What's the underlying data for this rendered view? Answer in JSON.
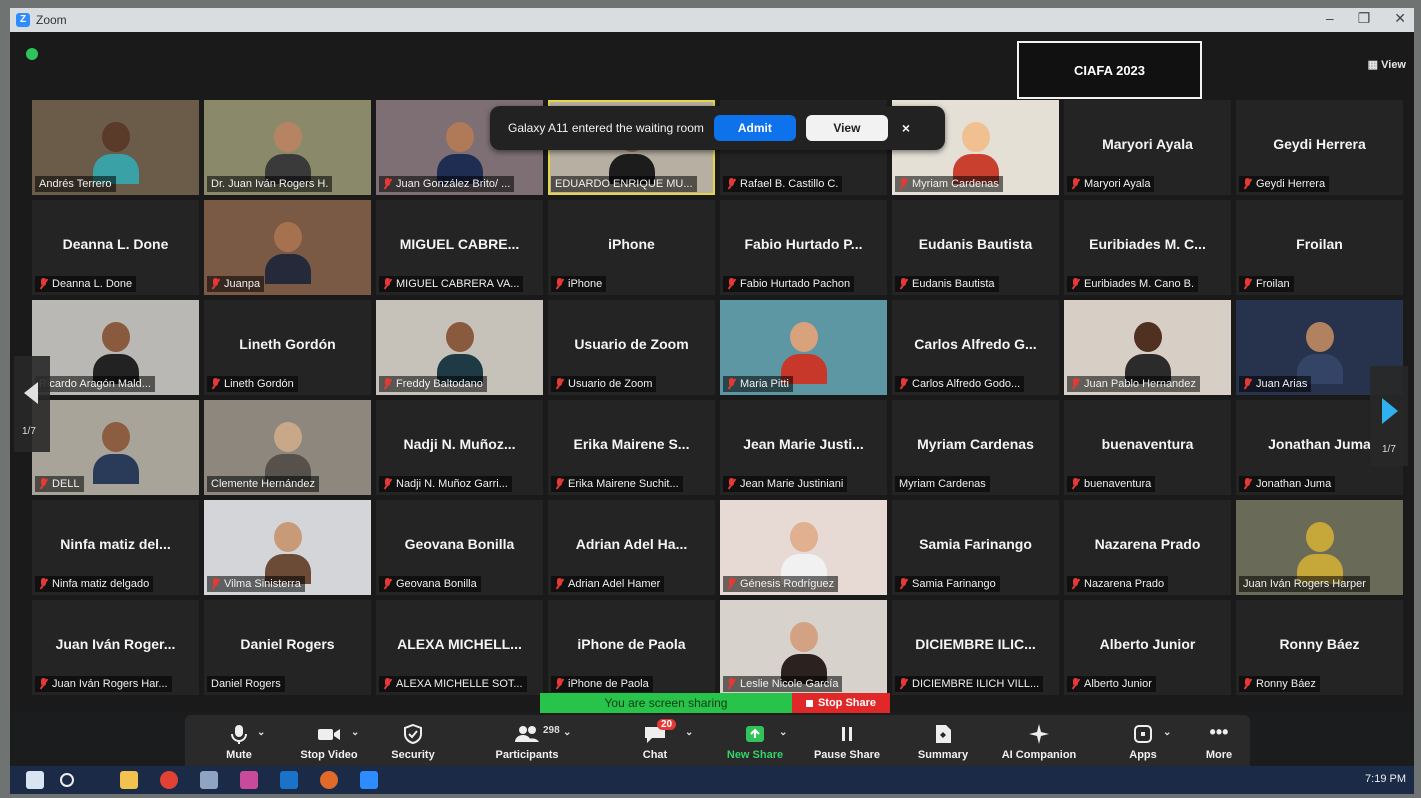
{
  "window": {
    "app_name": "Zoom",
    "view_label": "View"
  },
  "banner": {
    "text": "CIAFA 2023"
  },
  "waiting_room": {
    "message": "Galaxy A11 entered the waiting room",
    "admit_label": "Admit",
    "view_label": "View",
    "close_glyph": "×"
  },
  "pager": {
    "left_page": "1/7",
    "right_page": "1/7"
  },
  "tiles": [
    {
      "video": true,
      "bg": "#6b5b49",
      "skin": "#5a3a28",
      "shirt": "#3aa2a6",
      "label": "Andrés Terrero",
      "muted": false
    },
    {
      "video": true,
      "bg": "#8a8a6a",
      "skin": "#b68463",
      "shirt": "#3a3a3a",
      "label": "Dr. Juan Iván Rogers H.",
      "muted": false
    },
    {
      "video": true,
      "bg": "#7d6f73",
      "skin": "#b07a58",
      "shirt": "#1f2d52",
      "label": "Juan González Brito/ ...",
      "muted": true
    },
    {
      "video": true,
      "bg": "#b7b0a2",
      "skin": "#a07056",
      "shirt": "#1c1c1c",
      "label": "EDUARDO ENRIQUE MU...",
      "muted": false,
      "active": true
    },
    {
      "video": false,
      "name": "Rafael B. Castill...",
      "label": "Rafael B. Castillo C.",
      "muted": true
    },
    {
      "video": true,
      "bg": "#e5e0d6",
      "skin": "#f0c090",
      "shirt": "#c9412e",
      "label": "Myriam Cardenas",
      "muted": true
    },
    {
      "video": false,
      "name": "Maryori Ayala",
      "label": "Maryori Ayala",
      "muted": true
    },
    {
      "video": false,
      "name": "Geydi Herrera",
      "label": "Geydi Herrera",
      "muted": true
    },
    {
      "video": false,
      "name": "Deanna L. Done",
      "label": "Deanna L. Done",
      "muted": true
    },
    {
      "video": true,
      "bg": "#7a5a45",
      "skin": "#a6714f",
      "shirt": "#242a3a",
      "label": "Juanpa",
      "muted": true
    },
    {
      "video": false,
      "name": "MIGUEL CABRE...",
      "label": "MIGUEL CABRERA VA...",
      "muted": true
    },
    {
      "video": false,
      "name": "iPhone",
      "label": "iPhone",
      "muted": true
    },
    {
      "video": false,
      "name": "Fabio Hurtado P...",
      "label": "Fabio Hurtado Pachon",
      "muted": true
    },
    {
      "video": false,
      "name": "Eudanis Bautista",
      "label": "Eudanis Bautista",
      "muted": true
    },
    {
      "video": false,
      "name": "Euribiades M. C...",
      "label": "Euribiades M. Cano B.",
      "muted": true
    },
    {
      "video": false,
      "name": "Froilan",
      "label": "Froilan",
      "muted": true
    },
    {
      "video": true,
      "bg": "#b9b8b4",
      "skin": "#8a5a3e",
      "shirt": "#222222",
      "label": "Ricardo Aragón Mald...",
      "muted": false
    },
    {
      "video": false,
      "name": "Lineth Gordón",
      "label": "Lineth Gordón",
      "muted": true
    },
    {
      "video": true,
      "bg": "#c6c2b9",
      "skin": "#8a5a3e",
      "shirt": "#1e3a44",
      "label": "Freddy Baltodano",
      "muted": true
    },
    {
      "video": false,
      "name": "Usuario de Zoom",
      "label": "Usuario de Zoom",
      "muted": true
    },
    {
      "video": true,
      "bg": "#5e97a4",
      "skin": "#d8a27c",
      "shirt": "#c7382a",
      "label": "Maria Pitti",
      "muted": true
    },
    {
      "video": false,
      "name": "Carlos Alfredo G...",
      "label": "Carlos Alfredo Godo...",
      "muted": true
    },
    {
      "video": true,
      "bg": "#d7cfc5",
      "skin": "#4f3021",
      "shirt": "#2b2b2b",
      "label": "Juan Pablo Hernandez",
      "muted": true
    },
    {
      "video": true,
      "bg": "#27324d",
      "skin": "#b0825f",
      "shirt": "#334466",
      "label": "Juan Arias",
      "muted": true
    },
    {
      "video": true,
      "bg": "#a9a49a",
      "skin": "#8c5d40",
      "shirt": "#2a3b5a",
      "label": "DELL",
      "muted": true
    },
    {
      "video": true,
      "bg": "#8d877d",
      "skin": "#c9a88a",
      "shirt": "#56524b",
      "label": "Clemente Hernández",
      "muted": false
    },
    {
      "video": false,
      "name": "Nadji N. Muñoz...",
      "label": "Nadji N. Muñoz Garri...",
      "muted": true
    },
    {
      "video": false,
      "name": "Erika  Mairene S...",
      "label": "Erika  Mairene Suchit...",
      "muted": true
    },
    {
      "video": false,
      "name": "Jean Marie Justi...",
      "label": "Jean Marie Justiniani",
      "muted": true
    },
    {
      "video": false,
      "name": "Myriam Cardenas",
      "label": "Myriam Cardenas",
      "muted": false
    },
    {
      "video": false,
      "name": "buenaventura",
      "label": "buenaventura",
      "muted": true
    },
    {
      "video": false,
      "name": "Jonathan Juma",
      "label": "Jonathan Juma",
      "muted": true
    },
    {
      "video": false,
      "name": "Ninfa matiz del...",
      "label": "Ninfa matiz delgado",
      "muted": true
    },
    {
      "video": true,
      "bg": "#d3d5d8",
      "skin": "#c99a78",
      "shirt": "#6b4a36",
      "label": "Vilma Sinisterra",
      "muted": true
    },
    {
      "video": false,
      "name": "Geovana Bonilla",
      "label": "Geovana Bonilla",
      "muted": true
    },
    {
      "video": false,
      "name": "Adrian Adel Ha...",
      "label": "Adrian Adel Hamer",
      "muted": true
    },
    {
      "video": true,
      "bg": "#e7d9d3",
      "skin": "#e0b090",
      "shirt": "#f1f1f1",
      "label": "Génesis Rodríguez",
      "muted": true
    },
    {
      "video": false,
      "name": "Samia Farinango",
      "label": "Samia Farinango",
      "muted": true
    },
    {
      "video": false,
      "name": "Nazarena Prado",
      "label": "Nazarena Prado",
      "muted": true
    },
    {
      "video": true,
      "bg": "#6a6a58",
      "skin": "#c6a83a",
      "shirt": "#c6a83a",
      "label": "Juan Iván Rogers Harper",
      "muted": false
    },
    {
      "video": false,
      "name": "Juan Iván Roger...",
      "label": "Juan Iván Rogers Har...",
      "muted": true
    },
    {
      "video": false,
      "name": "Daniel Rogers",
      "label": "Daniel Rogers",
      "muted": false
    },
    {
      "video": false,
      "name": "ALEXA MICHELL...",
      "label": "ALEXA MICHELLE SOT...",
      "muted": true
    },
    {
      "video": false,
      "name": "iPhone de Paola",
      "label": "iPhone de Paola",
      "muted": true
    },
    {
      "video": true,
      "bg": "#d8d2cc",
      "skin": "#d3a282",
      "shirt": "#2b2220",
      "label": "Leslie Nicole García",
      "muted": true
    },
    {
      "video": false,
      "name": "DICIEMBRE ILIC...",
      "label": "DICIEMBRE ILICH VILL...",
      "muted": true
    },
    {
      "video": false,
      "name": "Alberto Junior",
      "label": "Alberto Junior",
      "muted": true
    },
    {
      "video": false,
      "name": "Ronny Báez",
      "label": "Ronny Báez",
      "muted": true
    }
  ],
  "share_bar": {
    "status": "You are screen sharing",
    "stop_label": "Stop Share"
  },
  "toolbar": {
    "mute": "Mute",
    "stop_video": "Stop Video",
    "security": "Security",
    "participants": "Participants",
    "participants_count": "298",
    "chat": "Chat",
    "chat_badge": "20",
    "new_share": "New Share",
    "pause_share": "Pause Share",
    "summary": "Summary",
    "ai_companion": "AI Companion",
    "apps": "Apps",
    "more": "More"
  },
  "taskbar": {
    "time": "7:19 PM"
  },
  "colors": {
    "accent_blue": "#0e72ed",
    "share_green": "#27c34a",
    "stop_red": "#e02828",
    "muted_red": "#e53935"
  }
}
